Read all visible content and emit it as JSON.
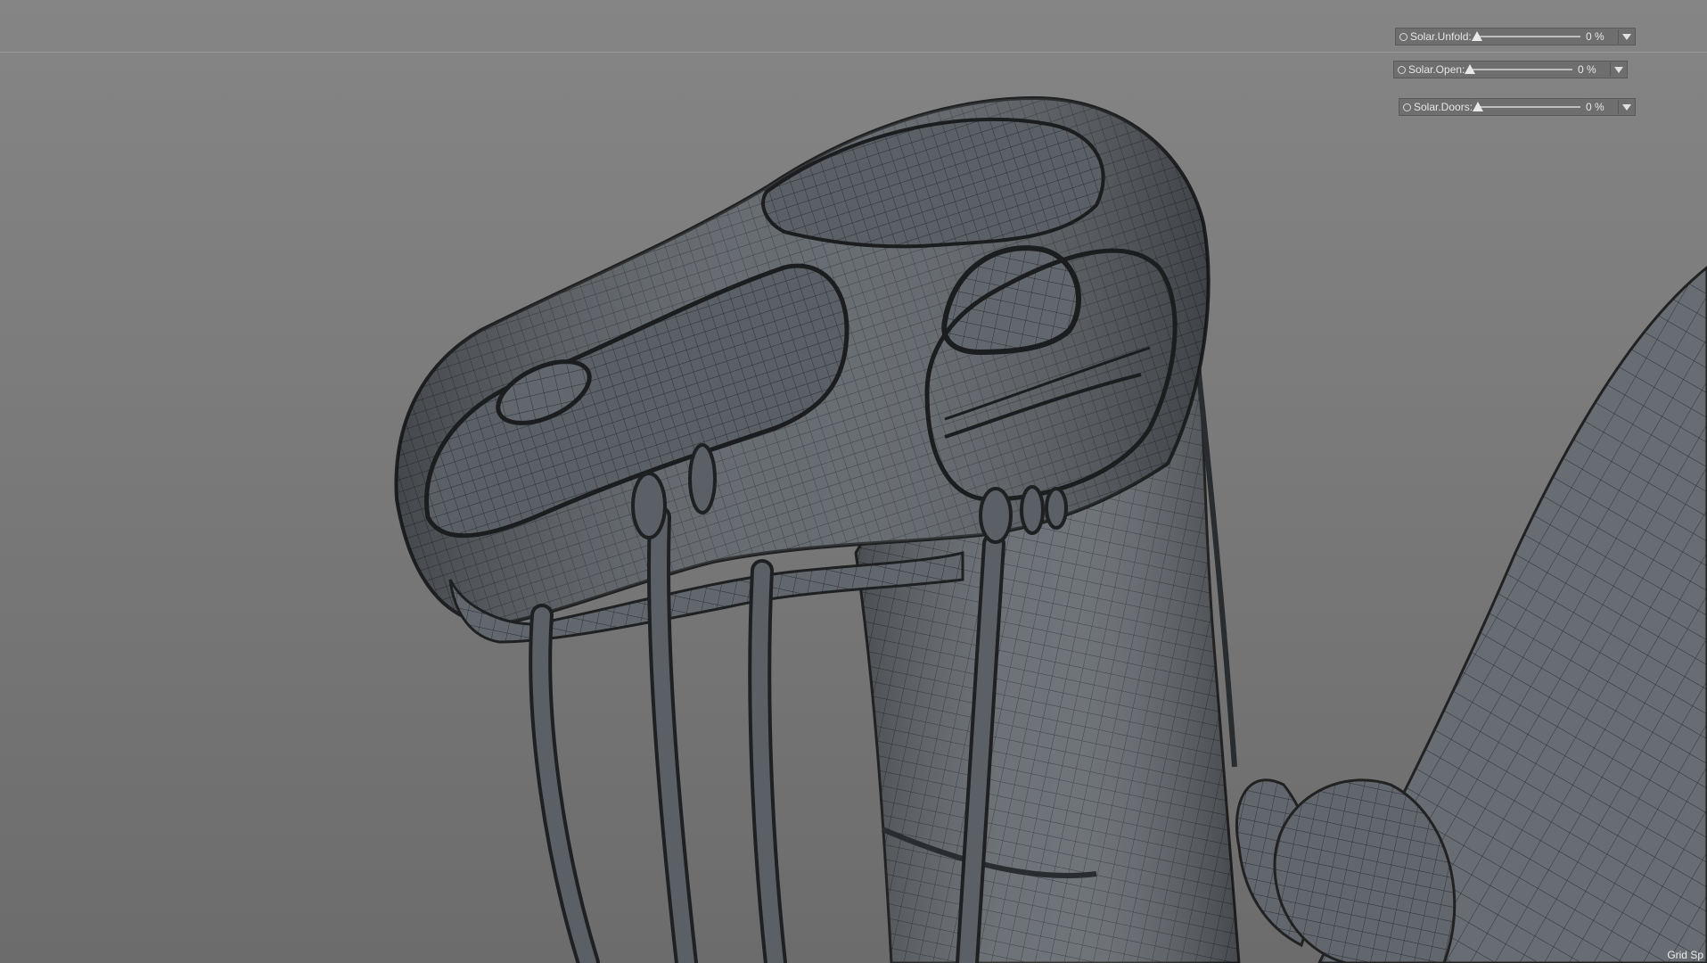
{
  "viewport": {
    "grid_label": "Grid Sp"
  },
  "controls": [
    {
      "label": "Solar.Unfold:",
      "value": "0 %",
      "level": 0
    },
    {
      "label": "Solar.Open:",
      "value": "0 %",
      "level": 0
    },
    {
      "label": "Solar.Doors:",
      "value": "0 %",
      "level": 0
    }
  ],
  "colors": {
    "mesh_fill": "#5b6066",
    "mesh_wire": "#2c2f33",
    "background_top": "#858585",
    "background_bottom": "#6c6c6c"
  },
  "icons": {
    "radio": "radio-icon",
    "dropdown": "chevron-down-icon"
  }
}
